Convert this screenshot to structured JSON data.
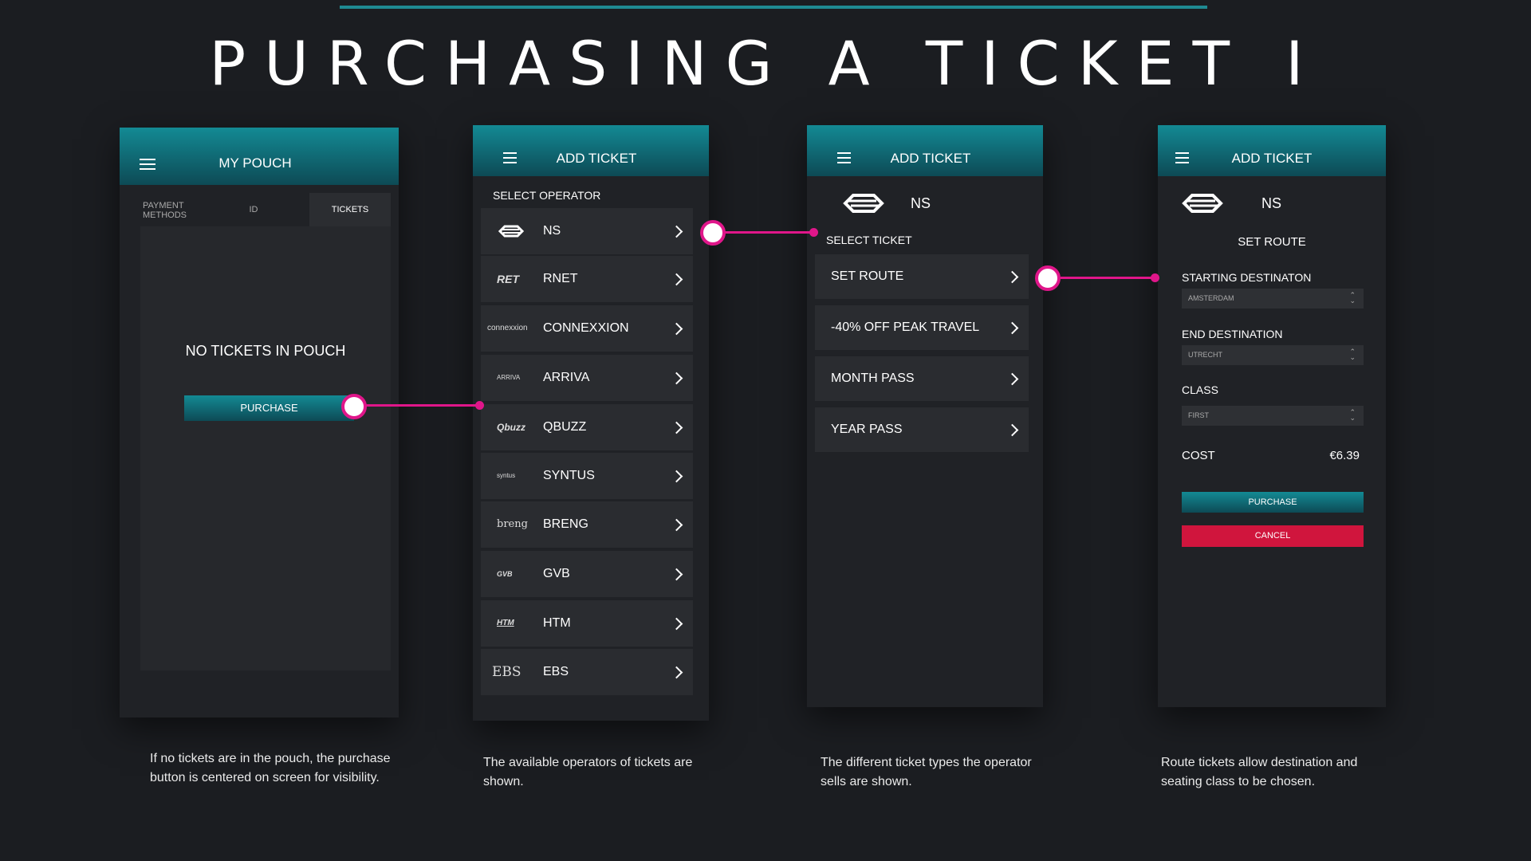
{
  "title": "PURCHASING A TICKET I",
  "screen1": {
    "header": "MY POUCH",
    "tabs": [
      "PAYMENT METHODS",
      "ID",
      "TICKETS"
    ],
    "empty_text": "NO TICKETS IN POUCH",
    "purchase": "PURCHASE",
    "caption": "If no tickets are in the pouch, the purchase button is centered on screen for visibility."
  },
  "screen2": {
    "header": "ADD TICKET",
    "section": "SELECT OPERATOR",
    "operators": [
      {
        "logo": "",
        "name": "NS"
      },
      {
        "logo": "RET",
        "name": "RNET"
      },
      {
        "logo": "connexxion",
        "name": "CONNEXXION"
      },
      {
        "logo": "ARRIVA",
        "name": "ARRIVA"
      },
      {
        "logo": "Qbuzz",
        "name": "QBUZZ"
      },
      {
        "logo": "syntus",
        "name": "SYNTUS"
      },
      {
        "logo": "breng",
        "name": "BRENG"
      },
      {
        "logo": "GVB",
        "name": "GVB"
      },
      {
        "logo": "HTM",
        "name": "HTM"
      },
      {
        "logo": "EBS",
        "name": "EBS"
      }
    ],
    "caption": "The available operators of tickets are shown."
  },
  "screen3": {
    "header": "ADD TICKET",
    "operator": "NS",
    "section": "SELECT TICKET",
    "tickets": [
      "SET ROUTE",
      "-40% OFF PEAK TRAVEL",
      "MONTH PASS",
      "YEAR PASS"
    ],
    "caption": "The different ticket types the operator sells are shown."
  },
  "screen4": {
    "header": "ADD TICKET",
    "operator": "NS",
    "subtitle": "SET ROUTE",
    "start_label": "STARTING DESTINATON",
    "start_value": "AMSTERDAM",
    "end_label": "END DESTINATION",
    "end_value": "UTRECHT",
    "class_label": "CLASS",
    "class_value": "FIRST",
    "cost_label": "COST",
    "cost_value": "€6.39",
    "purchase": "PURCHASE",
    "cancel": "CANCEL",
    "caption": "Route tickets allow destination and seating class to be chosen."
  },
  "colors": {
    "accent": "#128a94",
    "highlight": "#e0168a",
    "cancel": "#d0153d",
    "background": "#1b1d21"
  }
}
